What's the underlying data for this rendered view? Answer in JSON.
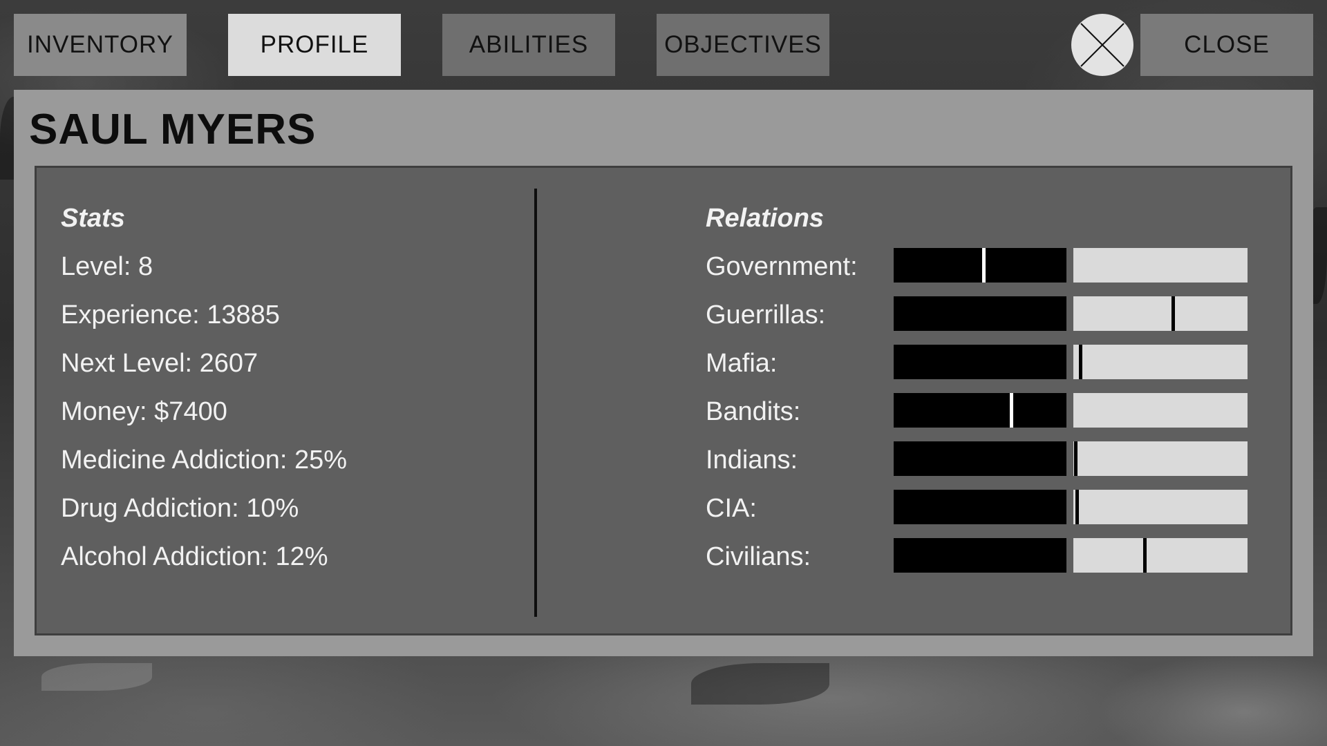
{
  "tabs": {
    "inventory": "INVENTORY",
    "profile": "PROFILE",
    "abilities": "ABILITIES",
    "objectives": "OBJECTIVES",
    "close": "CLOSE"
  },
  "character": {
    "name": "SAUL MYERS"
  },
  "stats": {
    "title": "Stats",
    "level": "Level: 8",
    "experience": "Experience: 13885",
    "next_level": "Next Level: 2607",
    "money": "Money: $7400",
    "medicine_addiction": "Medicine Addiction: 25%",
    "drug_addiction": "Drug Addiction: 10%",
    "alcohol_addiction": "Alcohol Addiction: 12%"
  },
  "relations": {
    "title": "Relations",
    "items": [
      {
        "label": "Government:",
        "value": -0.48
      },
      {
        "label": "Guerrillas:",
        "value": 0.57
      },
      {
        "label": "Mafia:",
        "value": 0.04
      },
      {
        "label": "Bandits:",
        "value": -0.32
      },
      {
        "label": "Indians:",
        "value": 0.01
      },
      {
        "label": "CIA:",
        "value": 0.02
      },
      {
        "label": "Civilians:",
        "value": 0.41
      }
    ]
  },
  "colors": {
    "negative_bar": "#000000",
    "positive_bar": "#dadada",
    "marker_on_negative": "#ffffff",
    "marker_on_positive": "#000000"
  }
}
